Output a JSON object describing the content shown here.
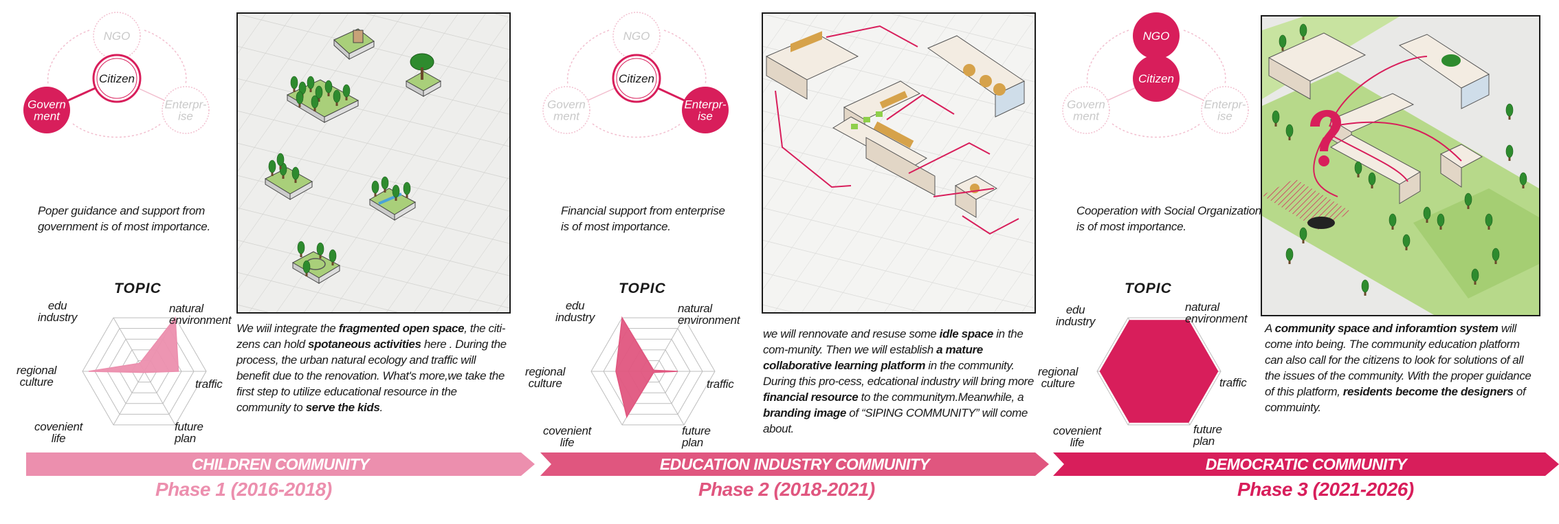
{
  "colors": {
    "accent": "#d81e5b",
    "pink1": "#ec8fae",
    "pink2": "#e0567f",
    "pink3": "#d81e5b",
    "faint": "#f2bfcf"
  },
  "stakeholders": {
    "ngo": "NGO",
    "citizen": "Citizen",
    "government": "Govern\nment",
    "enterprise": "Enterpr-\nise"
  },
  "topic_label": "TOPIC",
  "radar_axes": {
    "edu_industry": "edu\nindustry",
    "natural_environment": "natural\nenvironment",
    "traffic": "traffic",
    "future_plan": "future\nplan",
    "covenient_life": "covenient\nlife",
    "regional_culture": "regional\nculture"
  },
  "phases": [
    {
      "note": [
        "Poper guidance and support from",
        "government is of most importance."
      ],
      "highlight": [
        "citizen",
        "government"
      ],
      "bar_label": "CHILDREN COMMUNITY",
      "phase_label": "Phase  1 (2016-2018)",
      "radar_values": {
        "natural_environment": 1.0,
        "traffic": 0.55,
        "future_plan": 0.0,
        "covenient_life": 0.0,
        "regional_culture": 0.9,
        "edu_industry": 0.15
      },
      "paragraph": [
        {
          "t": "We wiil integrate the "
        },
        {
          "t": "fragmented open space",
          "b": true
        },
        {
          "t": ", the citi-zens can hold "
        },
        {
          "t": "spotaneous activities",
          "b": true
        },
        {
          "t": " here . During the process, the urban natural ecology and traffic will benefit due to the renovation. What's more,we take the first step to utilize educational resource in the community to "
        },
        {
          "t": "serve the kids",
          "b": true
        },
        {
          "t": "."
        }
      ]
    },
    {
      "note": [
        "Financial support from enterprise",
        "is of most importance."
      ],
      "highlight": [
        "citizen",
        "enterprise"
      ],
      "bar_label": "EDUCATION INDUSTRY COMMUNITY",
      "phase_label": "Phase  2 (2018-2021)",
      "radar_values": {
        "edu_industry": 1.0,
        "natural_environment": 0.0,
        "traffic": 0.4,
        "future_plan": 0.0,
        "covenient_life": 0.85,
        "regional_culture": 0.6
      },
      "paragraph": [
        {
          "t": "we will rennovate and resuse some "
        },
        {
          "t": "idle space",
          "b": true
        },
        {
          "t": " in the com-munity. Then we will establish "
        },
        {
          "t": "a mature collaborative learning platform",
          "b": true
        },
        {
          "t": " in the community. During this pro-cess, edcational industry will bring more "
        },
        {
          "t": "financial resource",
          "b": true
        },
        {
          "t": " to the communitym.Meanwhile, a "
        },
        {
          "t": "branding image",
          "b": true
        },
        {
          "t": " of “SIPING COMMUNITY” will come about."
        }
      ]
    },
    {
      "note": [
        "Cooperation with Social Organization",
        "is of most importance."
      ],
      "highlight": [
        "ngo",
        "citizen"
      ],
      "bar_label": "DEMOCRATIC COMMUNITY",
      "phase_label": "Phase  3 (2021-2026)",
      "radar_values": {
        "edu_industry": 0.95,
        "natural_environment": 0.95,
        "traffic": 0.95,
        "future_plan": 0.95,
        "covenient_life": 0.95,
        "regional_culture": 0.95
      },
      "paragraph": [
        {
          "t": "A "
        },
        {
          "t": "community space and inforamtion system",
          "b": true
        },
        {
          "t": " will come into being. The community education platform can also call for the citizens to look for solutions of all the issues of the community. With the proper guidance of this platform, "
        },
        {
          "t": "residents become the designers",
          "b": true
        },
        {
          "t": " of commuinty."
        }
      ]
    }
  ]
}
